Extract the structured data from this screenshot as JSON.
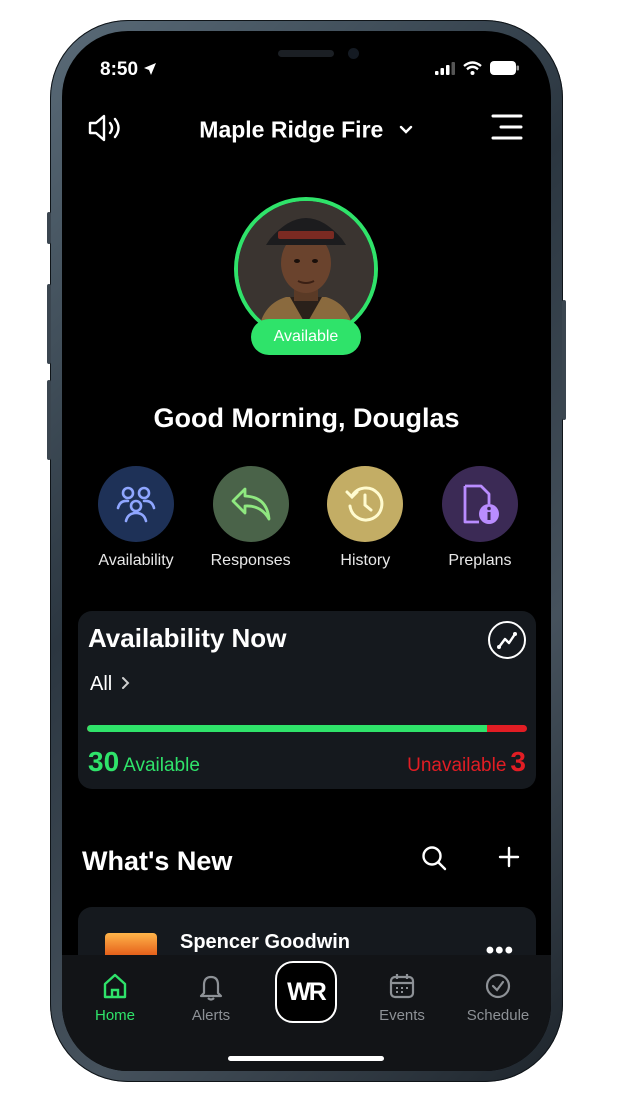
{
  "status": {
    "time": "8:50"
  },
  "header": {
    "title": "Maple Ridge Fire"
  },
  "profile": {
    "status_badge": "Available"
  },
  "greeting": "Good Morning, Douglas",
  "quick_actions": [
    {
      "label": "Availability",
      "icon": "people-icon",
      "bg": "#1e3157",
      "fg": "#8fa6ff"
    },
    {
      "label": "Responses",
      "icon": "reply-icon",
      "bg": "#4a6349",
      "fg": "#8fe880"
    },
    {
      "label": "History",
      "icon": "history-icon",
      "bg": "#c3ad65",
      "fg": "#fffbd0"
    },
    {
      "label": "Preplans",
      "icon": "document-info-icon",
      "bg": "#3b2a55",
      "fg": "#b98cff"
    }
  ],
  "availability": {
    "title": "Availability Now",
    "filter": "All",
    "available_count": "30",
    "available_label": "Available",
    "unavailable_label": "Unavailable",
    "unavailable_count": "3",
    "available_fraction": 0.909
  },
  "whats_new": {
    "title": "What's New",
    "items": [
      {
        "name": "Spencer Goodwin"
      }
    ]
  },
  "tabs": [
    {
      "label": "Home",
      "icon": "home-icon",
      "active": true
    },
    {
      "label": "Alerts",
      "icon": "bell-icon"
    },
    {
      "label": "WR",
      "icon": "wr-logo"
    },
    {
      "label": "Events",
      "icon": "calendar-icon"
    },
    {
      "label": "Schedule",
      "icon": "check-circle-icon"
    }
  ],
  "colors": {
    "accent": "#2fe36a",
    "danger": "#e21d24",
    "background": "#000000",
    "card": "#15191e"
  }
}
